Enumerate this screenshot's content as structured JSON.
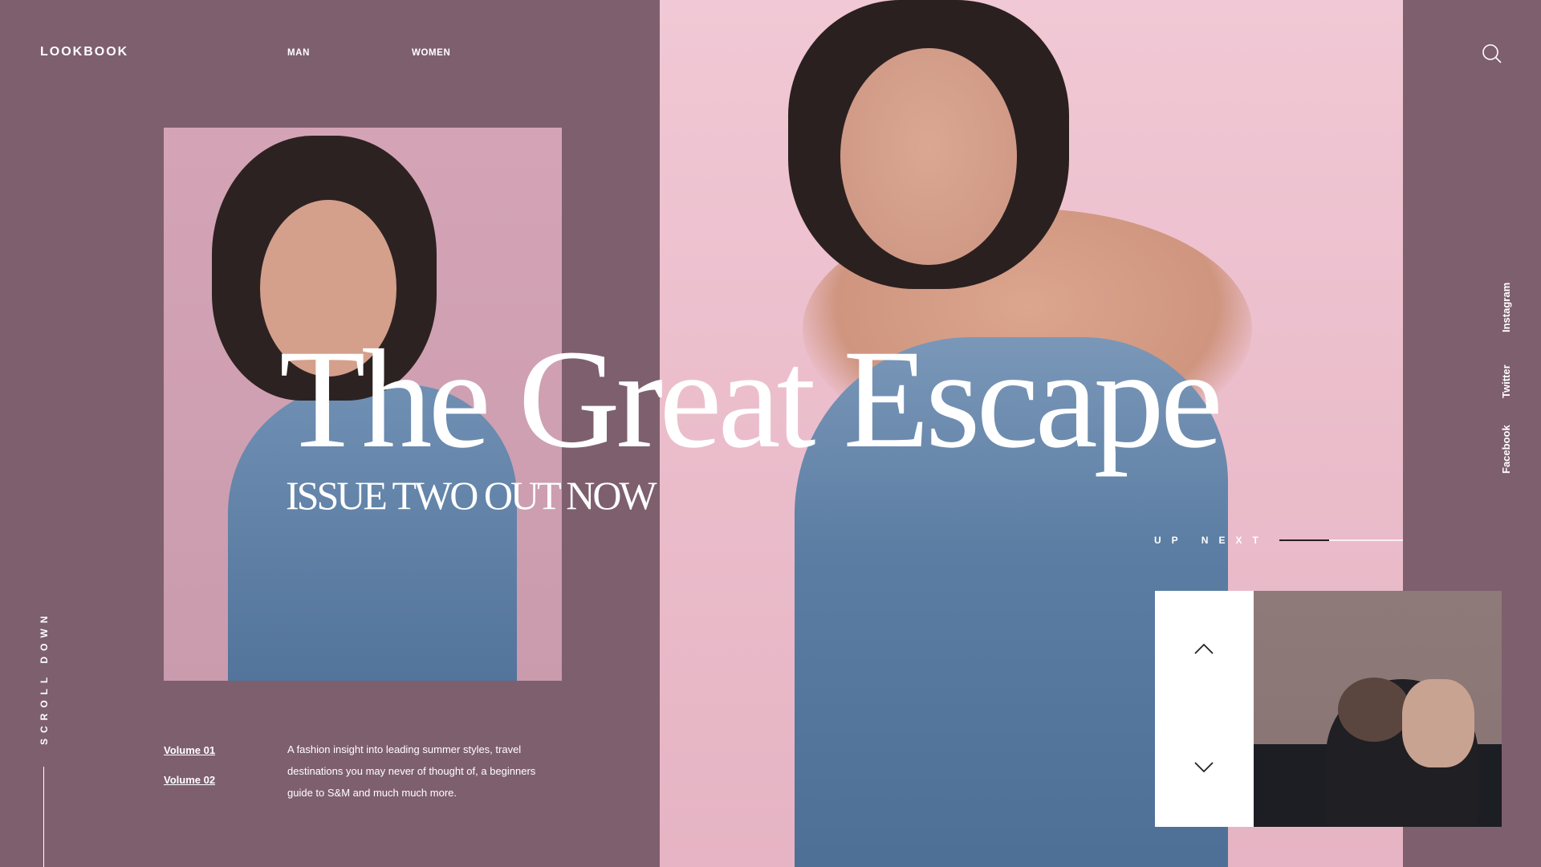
{
  "brand": {
    "logo": "LOOKBOOK"
  },
  "nav": {
    "items": [
      {
        "label": "MAN"
      },
      {
        "label": "WOMEN"
      }
    ]
  },
  "hero": {
    "title": "The Great Escape",
    "subtitle": "ISSUE TWO OUT NOW"
  },
  "up_next": {
    "label": "UP NEXT",
    "progress": 0.4
  },
  "social": {
    "items": [
      {
        "label": "Instagram"
      },
      {
        "label": "Twitter"
      },
      {
        "label": "Facebook"
      }
    ]
  },
  "scroll": {
    "label": "SCROLL DOWN"
  },
  "volumes": {
    "items": [
      {
        "label": "Volume 01"
      },
      {
        "label": "Volume 02"
      }
    ]
  },
  "description": "A fashion insight into leading summer styles, travel destinations you may never of thought of, a beginners guide to S&M and much much more.",
  "colors": {
    "background": "#7e5f6e",
    "hero_background": "#f1c8d5",
    "text": "#ffffff"
  },
  "icons": {
    "menu": "hamburger-icon",
    "search": "search-icon",
    "prev": "chevron-up-icon",
    "next": "chevron-down-icon"
  }
}
